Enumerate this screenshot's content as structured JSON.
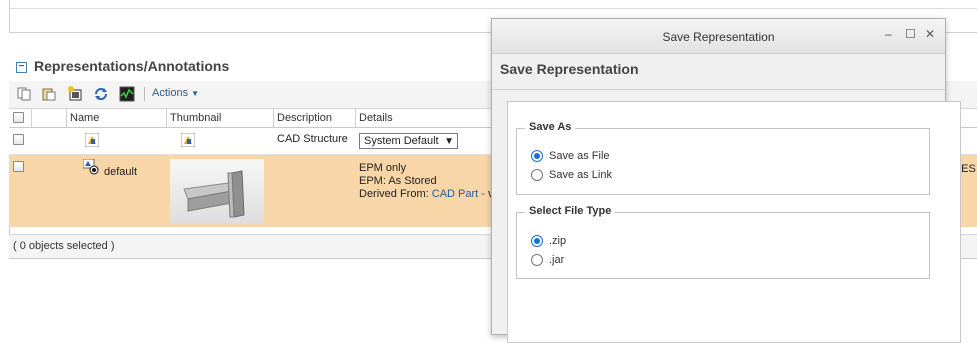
{
  "section": {
    "title": "Representations/Annotations",
    "toggle": "−"
  },
  "toolbar": {
    "actions_label": "Actions"
  },
  "table": {
    "columns": [
      "Name",
      "Thumbnail",
      "Description",
      "Details"
    ],
    "row1": {
      "description": "CAD Structure",
      "details_select": "System Default"
    },
    "row2": {
      "name": "default",
      "details_line1": "EPM only",
      "details_line2": "EPM: As Stored",
      "details_line3_prefix": "Derived From: ",
      "details_line3_link": "CAD Part - ",
      "details_line3_cut": "v",
      "trailing_text": "4 CES"
    },
    "status": "( 0 objects selected )"
  },
  "dialog": {
    "window_title": "Save Representation",
    "heading": "Save Representation",
    "controls": {
      "minimize": "–",
      "maximize": "☐",
      "close": "✕"
    },
    "save_as": {
      "legend": "Save As",
      "options": [
        {
          "label": "Save as File",
          "selected": true
        },
        {
          "label": "Save as Link",
          "selected": false
        }
      ]
    },
    "file_type": {
      "legend": "Select File Type",
      "options": [
        {
          "label": ".zip",
          "selected": true
        },
        {
          "label": ".jar",
          "selected": false
        }
      ]
    }
  },
  "colors": {
    "selected_row": "#f8d6a8",
    "link": "#2a5d95",
    "radio_on": "#1a6fd6"
  }
}
